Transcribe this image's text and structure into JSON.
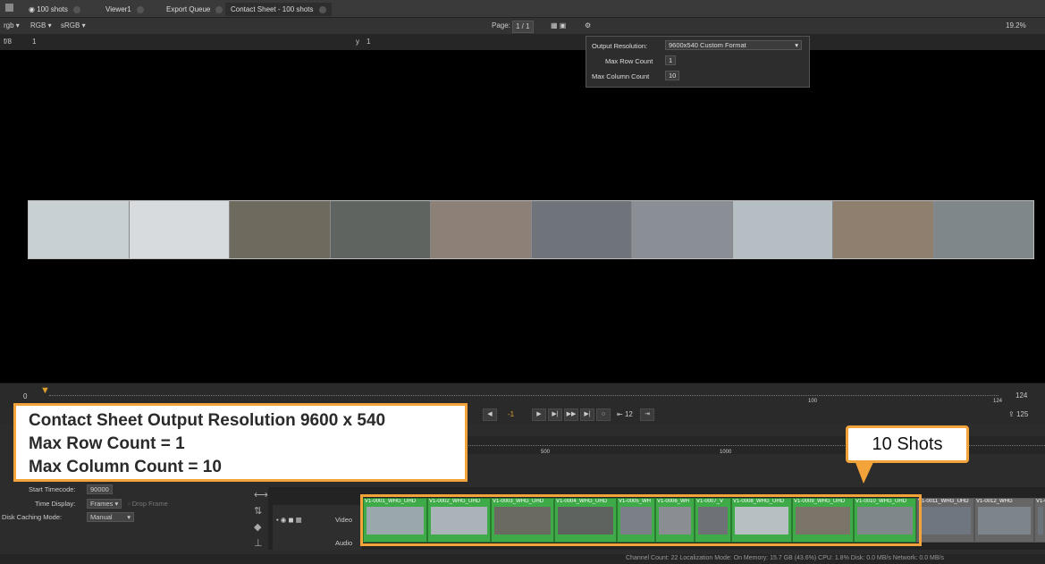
{
  "tabs": [
    {
      "label": "100 shots"
    },
    {
      "label": "Viewer1"
    },
    {
      "label": "Export Queue"
    },
    {
      "label": "Contact Sheet - 100 shots"
    }
  ],
  "viewer_toolbar": {
    "layer": "rgb",
    "channels": "RGB",
    "colorspace": "sRGB",
    "page_label": "Page:",
    "page_value": "1 / 1",
    "zoom": "19.2%"
  },
  "ruler": {
    "fstop": "f/8",
    "frame": "1",
    "y_label": "y",
    "y_value": "1"
  },
  "popup": {
    "output_resolution_label": "Output Resolution:",
    "output_resolution_value": "9600x540 Custom Format",
    "max_row_label": "Max Row Count",
    "max_row_value": "1",
    "max_col_label": "Max Column Count",
    "max_col_value": "10"
  },
  "scrub": {
    "start": "0",
    "mid_tick": "100",
    "end_tick": "124",
    "end_frame": "124",
    "out_frame": "125"
  },
  "transport": {
    "current": "-1",
    "step": "12"
  },
  "timeline": {
    "tick_500": "500",
    "tick_1000": "1000",
    "video_label": "Video",
    "audio_label": "Audio"
  },
  "left_panel": {
    "start_tc_label": "Start Timecode:",
    "start_tc_value": "90000",
    "time_display_label": "Time Display:",
    "time_display_value": "Frames",
    "drop_frame_label": "Drop Frame",
    "disk_caching_label": "Disk Caching Mode:",
    "disk_caching_value": "Manual"
  },
  "clips": [
    {
      "name": "V1-0001_WHG_UHD",
      "color": "#9aa7ad"
    },
    {
      "name": "V1-0002_WHG_UHD",
      "color": "#aab3b8"
    },
    {
      "name": "V1-0003_WHG_UHD",
      "color": "#6b6a60"
    },
    {
      "name": "V1-0004_WHG_UHD",
      "color": "#5e6360"
    },
    {
      "name": "V1-0005_WH",
      "color": "#7a7f88"
    },
    {
      "name": "V1-0006_WH",
      "color": "#8a8e92"
    },
    {
      "name": "V1-0007_V",
      "color": "#6e7276"
    },
    {
      "name": "V1-0008_WHG_UHD",
      "color": "#b7bfc3"
    },
    {
      "name": "V1-0009_WHG_UHD",
      "color": "#7b7469"
    },
    {
      "name": "V1-0010_WHG_UHD",
      "color": "#7f878b"
    },
    {
      "name": "V1-0011_WHG_UHD",
      "color": "#6f7680"
    },
    {
      "name": "V1-0012_WHG",
      "color": "#7d848a"
    },
    {
      "name": "V1-0",
      "color": "#6d737a"
    }
  ],
  "strip_colors": [
    "#c9d0d4",
    "#d7dbdd",
    "#6f6a5e",
    "#5f6461",
    "#8c8077",
    "#6f747a",
    "#8a8f96",
    "#b5bec2",
    "#8e7f6f",
    "#7f878b"
  ],
  "annotation": {
    "line1": "Contact Sheet Output Resolution 9600 x 540",
    "line2": "Max Row Count = 1",
    "line3": "Max Column Count = 10",
    "callout": "10 Shots"
  },
  "status_bar": "Channel Count: 22  Localization Mode: On  Memory: 15.7 GB (43.6%)  CPU: 1.8%  Disk: 0.0 MB/s  Network: 0.0 MB/s",
  "colors": {
    "accent": "#f2a43a",
    "clip_green": "#3faa48",
    "frame_counter": "#e0a030"
  }
}
